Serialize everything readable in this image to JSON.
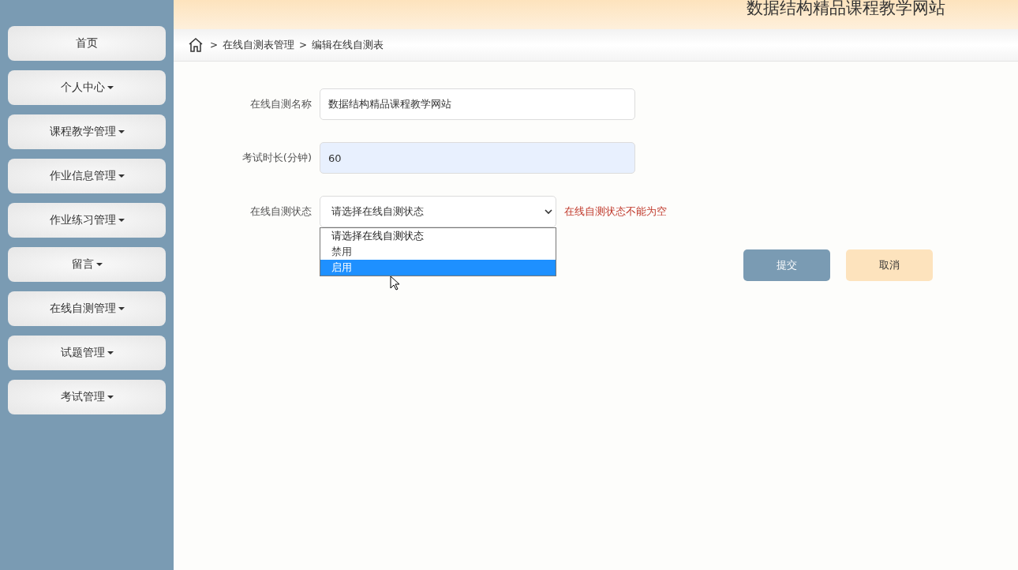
{
  "header": {
    "title": "数据结构精品课程教学网站"
  },
  "sidebar": {
    "items": [
      {
        "label": "首页",
        "kind": "link"
      },
      {
        "label": "个人中心",
        "kind": "dropdown"
      },
      {
        "label": "课程教学管理",
        "kind": "dropdown"
      },
      {
        "label": "作业信息管理",
        "kind": "dropdown"
      },
      {
        "label": "作业练习管理",
        "kind": "dropdown"
      },
      {
        "label": "留言",
        "kind": "dropdown"
      },
      {
        "label": "在线自测管理",
        "kind": "dropdown"
      },
      {
        "label": "试题管理",
        "kind": "dropdown"
      },
      {
        "label": "考试管理",
        "kind": "dropdown"
      }
    ]
  },
  "breadcrumb": {
    "separator": ">",
    "items": [
      "在线自测表管理",
      "编辑在线自测表"
    ]
  },
  "form": {
    "fields": [
      {
        "kind": "text",
        "label": "在线自测名称",
        "value": "数据结构精品课程教学网站",
        "highlighted": false
      },
      {
        "kind": "text",
        "label": "考试时长(分钟)",
        "value": "60",
        "highlighted": true
      },
      {
        "kind": "select",
        "label": "在线自测状态",
        "value": "请选择在线自测状态",
        "error": "在线自测状态不能为空",
        "expanded": true,
        "options": [
          {
            "label": "请选择在线自测状态",
            "selected": true,
            "highlighted": false
          },
          {
            "label": "禁用",
            "selected": false,
            "highlighted": false
          },
          {
            "label": "启用",
            "selected": false,
            "highlighted": true
          }
        ]
      }
    ],
    "buttons": [
      {
        "label": "提交",
        "kind": "primary"
      },
      {
        "label": "取消",
        "kind": "secondary"
      }
    ]
  }
}
